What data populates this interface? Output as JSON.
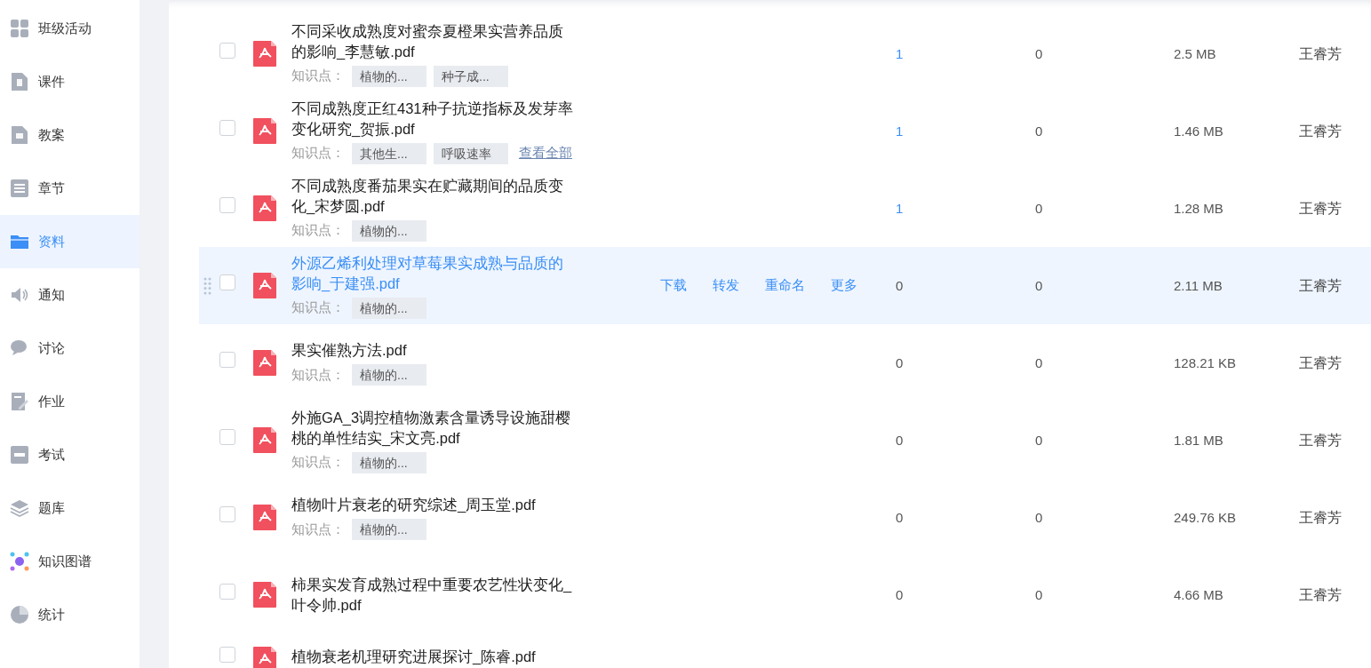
{
  "sidebar": {
    "items": [
      {
        "label": "班级活动",
        "selected": false
      },
      {
        "label": "课件",
        "selected": false
      },
      {
        "label": "教案",
        "selected": false
      },
      {
        "label": "章节",
        "selected": false
      },
      {
        "label": "资料",
        "selected": true
      },
      {
        "label": "通知",
        "selected": false
      },
      {
        "label": "讨论",
        "selected": false
      },
      {
        "label": "作业",
        "selected": false
      },
      {
        "label": "考试",
        "selected": false
      },
      {
        "label": "题库",
        "selected": false
      },
      {
        "label": "知识图谱",
        "selected": false
      },
      {
        "label": "统计",
        "selected": false
      }
    ]
  },
  "files": [
    {
      "title": "不同采收成熟度对蜜奈夏橙果实营养品质的影响_李慧敏.pdf",
      "highlighted": false,
      "checked": false,
      "tags_label": "知识点：",
      "tags": [
        "植物的...",
        "种子成..."
      ],
      "column_1": "1",
      "column_1_link": true,
      "column_2": "0",
      "size": "2.5 MB",
      "owner": "王睿芳"
    },
    {
      "title": "不同成熟度正红431种子抗逆指标及发芽率变化研究_贺振.pdf",
      "highlighted": false,
      "checked": false,
      "tags_label": "知识点：",
      "tags": [
        "其他生...",
        "呼吸速率"
      ],
      "view_all": "查看全部",
      "column_1": "1",
      "column_1_link": true,
      "column_2": "0",
      "size": "1.46 MB",
      "owner": "王睿芳"
    },
    {
      "title": "不同成熟度番茄果实在贮藏期间的品质变化_宋梦圆.pdf",
      "highlighted": false,
      "checked": false,
      "tags_label": "知识点：",
      "tags": [
        "植物的..."
      ],
      "column_1": "1",
      "column_1_link": true,
      "column_2": "0",
      "size": "1.28 MB",
      "owner": "王睿芳"
    },
    {
      "title": "外源乙烯利处理对草莓果实成熟与品质的影响_于建强.pdf",
      "highlighted": true,
      "checked": false,
      "tags_label": "知识点：",
      "tags": [
        "植物的..."
      ],
      "actions": [
        "下载",
        "转发",
        "重命名",
        "更多"
      ],
      "column_1": "0",
      "column_1_link": false,
      "column_2": "0",
      "size": "2.11 MB",
      "owner": "王睿芳"
    },
    {
      "title": "果实催熟方法.pdf",
      "highlighted": false,
      "checked": false,
      "tags_label": "知识点：",
      "tags": [
        "植物的..."
      ],
      "column_1": "0",
      "column_1_link": false,
      "column_2": "0",
      "size": "128.21 KB",
      "owner": "王睿芳"
    },
    {
      "title": "外施GA_3调控植物激素含量诱导设施甜樱桃的单性结实_宋文亮.pdf",
      "highlighted": false,
      "checked": false,
      "tags_label": "知识点：",
      "tags": [
        "植物的..."
      ],
      "column_1": "0",
      "column_1_link": false,
      "column_2": "0",
      "size": "1.81 MB",
      "owner": "王睿芳"
    },
    {
      "title": "植物叶片衰老的研究综述_周玉堂.pdf",
      "highlighted": false,
      "checked": false,
      "tags_label": "知识点：",
      "tags": [
        "植物的..."
      ],
      "column_1": "0",
      "column_1_link": false,
      "column_2": "0",
      "size": "249.76 KB",
      "owner": "王睿芳"
    },
    {
      "title": "柿果实发育成熟过程中重要农艺性状变化_叶令帅.pdf",
      "highlighted": false,
      "checked": false,
      "column_1": "0",
      "column_1_link": false,
      "column_2": "0",
      "size": "4.66 MB",
      "owner": "王睿芳"
    },
    {
      "title": "植物衰老机理研究进展探讨_陈睿.pdf",
      "highlighted": false,
      "checked": false
    }
  ]
}
